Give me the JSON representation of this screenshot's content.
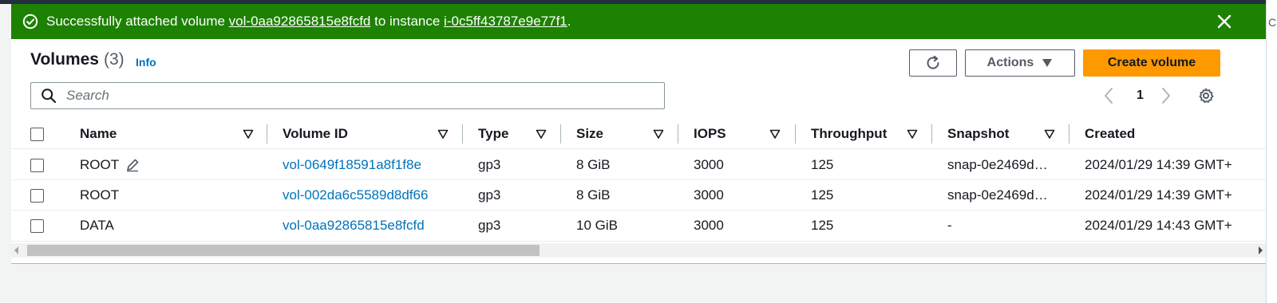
{
  "flash": {
    "prefix": "Successfully attached volume ",
    "volume_link": "vol-0aa92865815e8fcfd",
    "middle": " to instance ",
    "instance_link": "i-0c5ff43787e9e77f1",
    "suffix": ".",
    "icon": "check-circle-icon",
    "close_icon": "close-icon",
    "color": "#1d8102"
  },
  "header": {
    "title": "Volumes",
    "count": "(3)",
    "info": "Info",
    "actions_label": "Actions",
    "create_label": "Create volume",
    "accent": "#ff9900"
  },
  "search": {
    "placeholder": "Search",
    "value": ""
  },
  "pagination": {
    "current_page": "1"
  },
  "table": {
    "columns": [
      "Name",
      "Volume ID",
      "Type",
      "Size",
      "IOPS",
      "Throughput",
      "Snapshot",
      "Created"
    ],
    "rows": [
      {
        "name": "ROOT",
        "volume_id": "vol-0649f18591a8f1f8e",
        "type": "gp3",
        "size": "8 GiB",
        "iops": "3000",
        "throughput": "125",
        "snapshot": "snap-0e2469d…",
        "created": "2024/01/29 14:39 GMT+"
      },
      {
        "name": "ROOT",
        "volume_id": "vol-002da6c5589d8df66",
        "type": "gp3",
        "size": "8 GiB",
        "iops": "3000",
        "throughput": "125",
        "snapshot": "snap-0e2469d…",
        "created": "2024/01/29 14:39 GMT+"
      },
      {
        "name": "DATA",
        "volume_id": "vol-0aa92865815e8fcfd",
        "type": "gp3",
        "size": "10 GiB",
        "iops": "3000",
        "throughput": "125",
        "snapshot": "-",
        "created": "2024/01/29 14:43 GMT+"
      }
    ]
  },
  "edge": {
    "char": "C"
  }
}
